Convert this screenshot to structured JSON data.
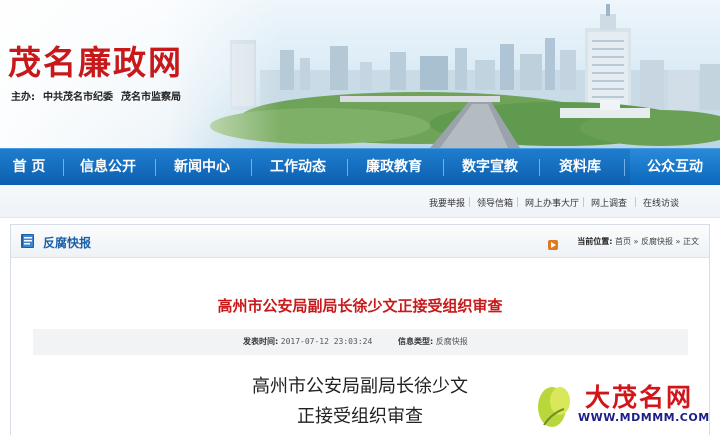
{
  "header": {
    "title": "茂名廉政网",
    "sponsor_label": "主办:",
    "sponsor_1": "中共茂名市纪委",
    "sponsor_2": "茂名市监察局"
  },
  "nav": {
    "items": [
      {
        "label": "首 页"
      },
      {
        "label": "信息公开"
      },
      {
        "label": "新闻中心"
      },
      {
        "label": "工作动态"
      },
      {
        "label": "廉政教育"
      },
      {
        "label": "数字宣教"
      },
      {
        "label": "资料库"
      },
      {
        "label": "公众互动"
      }
    ],
    "active_index": 7
  },
  "subnav": {
    "items": [
      {
        "label": "我要举报"
      },
      {
        "label": "领导信箱"
      },
      {
        "label": "网上办事大厅"
      },
      {
        "label": "网上调查"
      },
      {
        "label": "在线访谈"
      }
    ]
  },
  "panel": {
    "title": "反腐快报",
    "location_label": "当前位置:",
    "breadcrumb_home": "首页",
    "breadcrumb_sep": "»",
    "breadcrumb_section": "反腐快报",
    "breadcrumb_current": "正文"
  },
  "article": {
    "title": "高州市公安局副局长徐少文正接受组织审查",
    "publish_time_label": "发表时间:",
    "publish_time": "2017-07-12 23:03:24",
    "category_label": "信息类型:",
    "category": "反腐快报",
    "body_line1": "高州市公安局副局长徐少文",
    "body_line2": "正接受组织审查"
  },
  "watermark": {
    "text": "大茂名网",
    "url": "WWW.MDMMM.COM"
  },
  "colors": {
    "brand_red": "#c8191a",
    "nav_blue": "#0d5fb0",
    "link_blue": "#1a5fa8"
  }
}
